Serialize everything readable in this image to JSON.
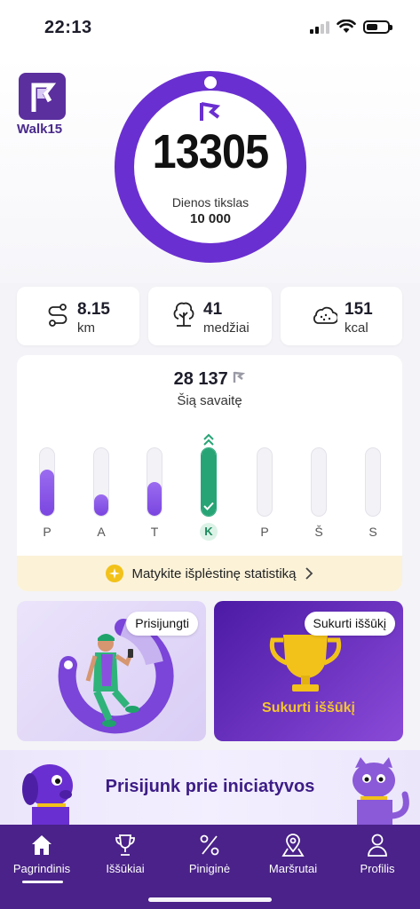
{
  "status_bar": {
    "time": "22:13"
  },
  "brand": {
    "name": "Walk15",
    "color": "#5b2f9e"
  },
  "progress": {
    "steps": "13305",
    "goal_label": "Dienos tikslas",
    "goal_value": "10 000",
    "ring_color": "#6a2fd0"
  },
  "stats": [
    {
      "icon": "route-icon",
      "value": "8.15",
      "unit": "km"
    },
    {
      "icon": "tree-icon",
      "value": "41",
      "unit": "medžiai"
    },
    {
      "icon": "cloud-icon",
      "value": "151",
      "unit": "kcal"
    }
  ],
  "week": {
    "total": "28 137",
    "label": "Šią savaitę",
    "days": [
      {
        "label": "P",
        "fraction": 0.68,
        "today": false
      },
      {
        "label": "A",
        "fraction": 0.31,
        "today": false
      },
      {
        "label": "T",
        "fraction": 0.5,
        "today": false
      },
      {
        "label": "K",
        "fraction": 1.0,
        "today": true
      },
      {
        "label": "P",
        "fraction": 0,
        "today": false
      },
      {
        "label": "Š",
        "fraction": 0,
        "today": false
      },
      {
        "label": "S",
        "fraction": 0,
        "today": false
      }
    ],
    "banner_text": "Matykite išplėstinę statistiką",
    "today_color": "#27a475"
  },
  "promos": {
    "left": {
      "chip": "Prisijungti"
    },
    "right": {
      "chip": "Sukurti iššūkį",
      "cta": "Sukurti iššūkį"
    }
  },
  "initiative": {
    "text": "Prisijunk prie iniciatyvos"
  },
  "nav": {
    "items": [
      {
        "label": "Pagrindinis",
        "icon": "home-icon",
        "active": true
      },
      {
        "label": "Iššūkiai",
        "icon": "trophy-icon",
        "active": false
      },
      {
        "label": "Piniginė",
        "icon": "percent-icon",
        "active": false
      },
      {
        "label": "Maršrutai",
        "icon": "map-pin-icon",
        "active": false
      },
      {
        "label": "Profilis",
        "icon": "user-icon",
        "active": false
      }
    ],
    "background": "#4a2289"
  }
}
